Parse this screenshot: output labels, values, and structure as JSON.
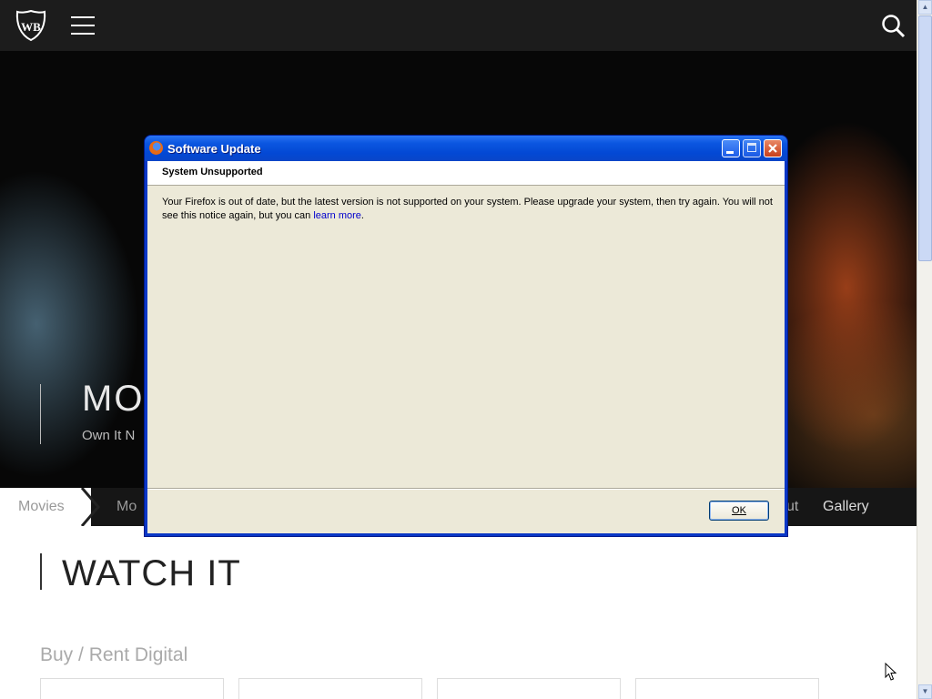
{
  "website": {
    "logo": "wb-shield-logo",
    "hero": {
      "title": "MO",
      "subtitle": "Own It N"
    },
    "nav": {
      "items": [
        "Movies",
        "Mo",
        "ut",
        "Gallery"
      ]
    },
    "watch_section": {
      "heading": "WATCH IT",
      "buy_label": "Buy / Rent   Digital"
    }
  },
  "dialog": {
    "title": "Software Update",
    "section_title": "System Unsupported",
    "message": "Your Firefox is out of date, but the latest version is not supported on your system. Please upgrade your system, then try again. You will not see this notice again, but you can ",
    "link_text": "learn more",
    "message_end": ".",
    "ok_label": "OK"
  },
  "colors": {
    "titlebar": "#0b56e0",
    "dialog_bg": "#ece9d8",
    "site_bar": "#1c1c1c",
    "link": "#0000cc"
  },
  "icons": [
    "firefox-icon",
    "minimize-icon",
    "maximize-icon",
    "close-icon",
    "menu-icon",
    "search-icon",
    "cursor-arrow-icon"
  ]
}
